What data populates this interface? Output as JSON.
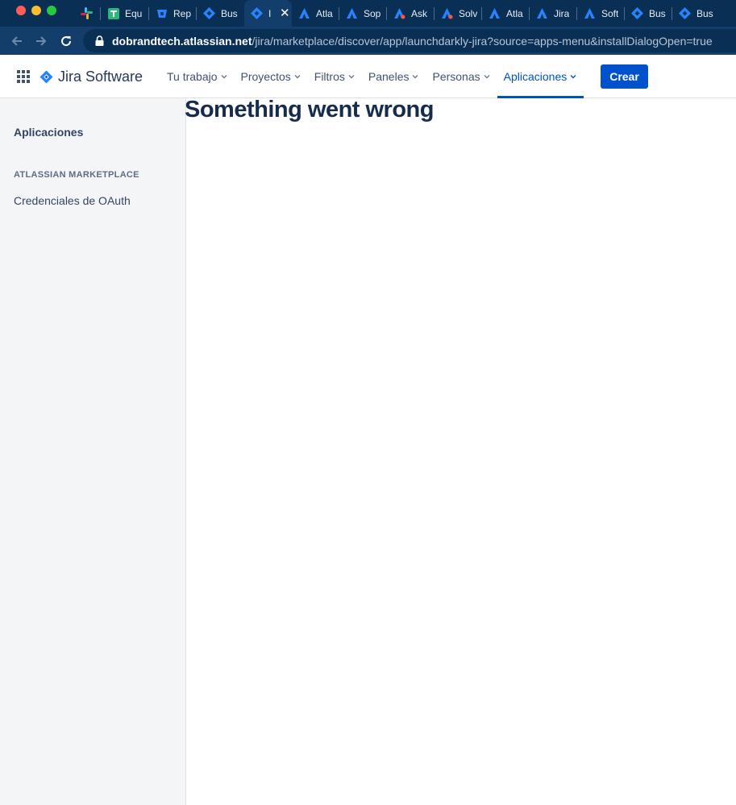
{
  "browser": {
    "tabs": [
      {
        "title": "",
        "icon": "slack-icon"
      },
      {
        "title": "Equ",
        "icon": "spreadsheet-icon"
      },
      {
        "title": "Rep",
        "icon": "bitbucket-icon"
      },
      {
        "title": "Bus",
        "icon": "jira-diamond-icon"
      },
      {
        "title": "I",
        "icon": "jira-diamond-icon",
        "active": true
      },
      {
        "title": "Atla",
        "icon": "atlassian-icon"
      },
      {
        "title": "Sop",
        "icon": "atlassian-icon"
      },
      {
        "title": "Ask",
        "icon": "atlassian-alert-icon"
      },
      {
        "title": "Solv",
        "icon": "atlassian-alert-icon"
      },
      {
        "title": "Atla",
        "icon": "atlassian-icon"
      },
      {
        "title": "Jira",
        "icon": "atlassian-icon"
      },
      {
        "title": "Soft",
        "icon": "atlassian-icon"
      },
      {
        "title": "Bus",
        "icon": "jira-diamond-icon"
      },
      {
        "title": "Bus",
        "icon": "jira-diamond-icon"
      }
    ],
    "url_host": "dobrandtech.atlassian.net",
    "url_path": "/jira/marketplace/discover/app/launchdarkly-jira?source=apps-menu&installDialogOpen=true"
  },
  "header": {
    "logo_text": "Jira Software",
    "nav": [
      {
        "label": "Tu trabajo"
      },
      {
        "label": "Proyectos"
      },
      {
        "label": "Filtros"
      },
      {
        "label": "Paneles"
      },
      {
        "label": "Personas"
      },
      {
        "label": "Aplicaciones",
        "active": true
      }
    ],
    "create_label": "Crear"
  },
  "sidebar": {
    "title": "Aplicaciones",
    "section_label": "ATLASSIAN MARKETPLACE",
    "items": [
      {
        "label": "Credenciales de OAuth"
      }
    ]
  },
  "main": {
    "error_title": "Something went wrong"
  },
  "colors": {
    "tabstrip_bg": "#0a2f55",
    "toolbar_bg": "#133e6b",
    "jira_blue": "#0052cc",
    "sidebar_bg": "#f4f5f7"
  }
}
